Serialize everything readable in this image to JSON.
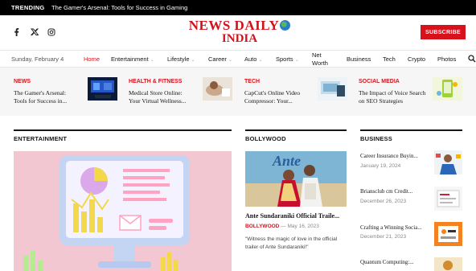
{
  "trending": {
    "label": "TRENDING",
    "text": "The Gamer's Arsenal: Tools for Success in Gaming"
  },
  "header": {
    "social_icons": [
      "facebook-icon",
      "twitter-icon",
      "instagram-icon"
    ],
    "logo_line1": "NEWS DAILY",
    "logo_line2": "INDIA",
    "subscribe_label": "SUBSCRIBE"
  },
  "nav": {
    "date": "Sunday, February 4",
    "items": [
      {
        "label": "Home",
        "active": true
      },
      {
        "label": "Entertainment"
      },
      {
        "label": "Lifestyle"
      },
      {
        "label": "Career"
      },
      {
        "label": "Auto"
      },
      {
        "label": "Sports"
      },
      {
        "label": "Net Worth"
      },
      {
        "label": "Business"
      },
      {
        "label": "Tech"
      },
      {
        "label": "Crypto"
      },
      {
        "label": "Photos"
      }
    ]
  },
  "ticker": [
    {
      "category": "NEWS",
      "title": "The Gamer's Arsenal: Tools for Success in..."
    },
    {
      "category": "HEALTH & FITNESS",
      "title": "Medical Store Online: Your Virtual Wellness..."
    },
    {
      "category": "TECH",
      "title": "CapCut's Online Video Compressor: Your..."
    },
    {
      "category": "SOCIAL MEDIA",
      "title": "The Impact of Voice Search on SEO Strategies"
    }
  ],
  "sections": {
    "entertainment": {
      "heading": "ENTERTAINMENT"
    },
    "bollywood": {
      "heading": "BOLLYWOOD",
      "title": "Ante Sundaraniki Official Traile...",
      "category": "BOLLYWOOD",
      "date": "May 16, 2023",
      "excerpt": "\"Witness the magic of love in the official trailer of Ante Sundaraniki!\""
    },
    "business": {
      "heading": "BUSINESS",
      "posts": [
        {
          "title": "Career Insurance Buyin...",
          "date": "January 19, 2024"
        },
        {
          "title": "Briansclub cm Credit...",
          "date": "December 26, 2023"
        },
        {
          "title": "Crafting a Winning Socia...",
          "date": "December 21, 2023"
        },
        {
          "title": "Quantum Computing:...",
          "date": ""
        }
      ]
    }
  },
  "colors": {
    "accent": "#d8121c",
    "trending_bar": "#000000"
  }
}
